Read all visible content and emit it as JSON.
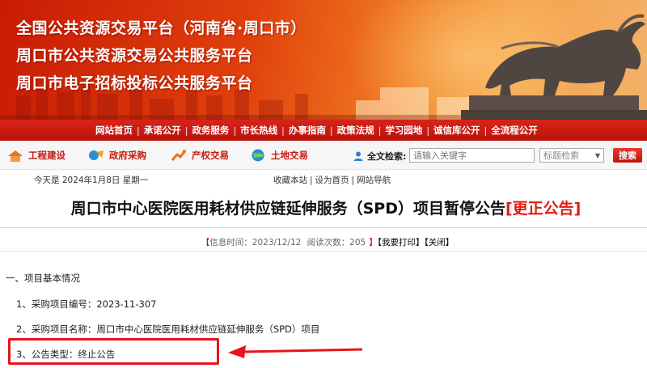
{
  "banner": {
    "line1": "全国公共资源交易平台（河南省·周口市）",
    "line2": "周口市公共资源交易公共服务平台",
    "line3": "周口市电子招标投标公共服务平台"
  },
  "nav": {
    "items": [
      "网站首页",
      "承诺公开",
      "政务服务",
      "市长热线",
      "办事指南",
      "政策法规",
      "学习园地",
      "诚信库公开",
      "全流程公开"
    ],
    "separator": "|"
  },
  "categories": [
    {
      "label": "工程建设",
      "icon": "construction-icon"
    },
    {
      "label": "政府采购",
      "icon": "procurement-icon"
    },
    {
      "label": "产权交易",
      "icon": "property-icon"
    },
    {
      "label": "土地交易",
      "icon": "land-globe-icon"
    }
  ],
  "search": {
    "label": "全文检索:",
    "placeholder": "请输入关键字",
    "select_value": "标题检索",
    "button_label": "搜索"
  },
  "info": {
    "date": "今天是 2024年1月8日 星期一",
    "links": [
      "收藏本站",
      "设为首页",
      "网站导航"
    ]
  },
  "article": {
    "title": "周口市中心医院医用耗材供应链延伸服务（SPD）项目暂停公告",
    "tag": "[更正公告]",
    "meta": {
      "open": "【",
      "time_label": "信息时间：",
      "time_value": "2023/12/12",
      "views_label": "阅读次数：",
      "views_value": "205",
      "close": "】",
      "print": "【我要打印】",
      "close_btn": "【关闭】"
    },
    "section1": "一、项目基本情况",
    "item1": "1、采购项目编号：2023-11-307",
    "item2": "2、采购项目名称：周口市中心医院医用耗材供应链延伸服务（SPD）项目",
    "item3": "3、公告类型：终止公告"
  },
  "colors": {
    "brand_red": "#c61a0e",
    "tag_red": "#e01b10",
    "highlight_red": "#e8141b"
  }
}
